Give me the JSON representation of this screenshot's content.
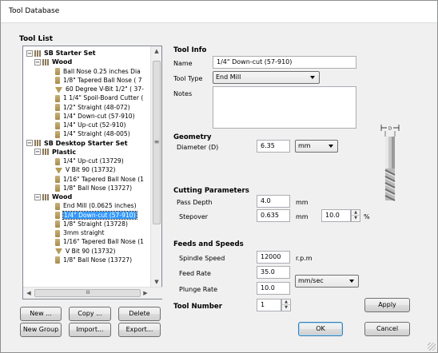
{
  "window": {
    "title": "Tool Database"
  },
  "tool_list": {
    "label": "Tool List",
    "tree": [
      {
        "level": 0,
        "kind": "folder",
        "label": "SB Starter Set",
        "bold": true,
        "toggle": "−"
      },
      {
        "level": 1,
        "kind": "folder",
        "label": "Wood",
        "bold": true,
        "toggle": "−"
      },
      {
        "level": 2,
        "kind": "tool",
        "label": "Ball Nose 0.25 inches Dia"
      },
      {
        "level": 2,
        "kind": "tool",
        "label": "1/8\" Tapered Ball Nose ( 7"
      },
      {
        "level": 2,
        "kind": "vbit",
        "label": "60 Degree V-Bit 1/2\" ( 37-"
      },
      {
        "level": 2,
        "kind": "tool",
        "label": "1 1/4\" Spoil-Board Cutter ("
      },
      {
        "level": 2,
        "kind": "tool",
        "label": "1/2\" Straight  (48-072)"
      },
      {
        "level": 2,
        "kind": "tool",
        "label": "1/4\"  Down-cut (57-910)"
      },
      {
        "level": 2,
        "kind": "tool",
        "label": "1/4\" Up-cut (52-910)"
      },
      {
        "level": 2,
        "kind": "tool",
        "label": "1/4\" Straight  (48-005)"
      },
      {
        "level": 0,
        "kind": "folder",
        "label": "SB Desktop Starter Set",
        "bold": true,
        "toggle": "−"
      },
      {
        "level": 1,
        "kind": "folder",
        "label": "Plastic",
        "bold": true,
        "toggle": "−"
      },
      {
        "level": 2,
        "kind": "tool",
        "label": "1/4\" Up-cut (13729)"
      },
      {
        "level": 2,
        "kind": "vbit",
        "label": "V Bit 90 (13732)"
      },
      {
        "level": 2,
        "kind": "tool",
        "label": "1/16\" Tapered Ball Nose (1"
      },
      {
        "level": 2,
        "kind": "tool",
        "label": "1/8\" Ball Nose (13727)"
      },
      {
        "level": 1,
        "kind": "folder",
        "label": "Wood",
        "bold": true,
        "toggle": "−"
      },
      {
        "level": 2,
        "kind": "tool",
        "label": "End Mill (0.0625 inches)"
      },
      {
        "level": 2,
        "kind": "tool",
        "label": "1/4\"  Down-cut (57-910)",
        "selected": true
      },
      {
        "level": 2,
        "kind": "tool",
        "label": "1/8\" Straight (13728)"
      },
      {
        "level": 2,
        "kind": "tool",
        "label": "3mm straight"
      },
      {
        "level": 2,
        "kind": "tool",
        "label": "1/16\" Tapered Ball Nose (1"
      },
      {
        "level": 2,
        "kind": "vbit",
        "label": "V Bit 90 (13732)"
      },
      {
        "level": 2,
        "kind": "tool",
        "label": "1/8\" Ball Nose (13727)"
      }
    ],
    "scroll_marker": "≡",
    "hscroll_marker": "III"
  },
  "buttons": {
    "new": "New ...",
    "copy": "Copy ...",
    "delete": "Delete",
    "new_group": "New Group",
    "import": "Import...",
    "export": "Export...",
    "apply": "Apply",
    "ok": "OK",
    "cancel": "Cancel"
  },
  "tool_info": {
    "heading": "Tool Info",
    "name_label": "Name",
    "name_value": "1/4\"  Down-cut (57-910)",
    "type_label": "Tool Type",
    "type_value": "End Mill",
    "notes_label": "Notes",
    "notes_value": ""
  },
  "geometry": {
    "heading": "Geometry",
    "diameter_label": "Diameter (D)",
    "diameter_value": "6.35",
    "diameter_unit": "mm",
    "diagram_label": "D"
  },
  "cutting": {
    "heading": "Cutting Parameters",
    "pass_depth_label": "Pass Depth",
    "pass_depth_value": "4.0",
    "pass_depth_unit": "mm",
    "stepover_label": "Stepover",
    "stepover_value": "0.635",
    "stepover_unit": "mm",
    "stepover_pct_value": "10.0",
    "stepover_pct_unit": "%"
  },
  "feeds": {
    "heading": "Feeds and Speeds",
    "spindle_label": "Spindle Speed",
    "spindle_value": "12000",
    "spindle_unit": "r.p.m",
    "feed_label": "Feed Rate",
    "feed_value": "35.0",
    "plunge_label": "Plunge Rate",
    "plunge_value": "10.0",
    "rate_unit": "mm/sec"
  },
  "tool_number": {
    "label": "Tool Number",
    "value": "1"
  }
}
